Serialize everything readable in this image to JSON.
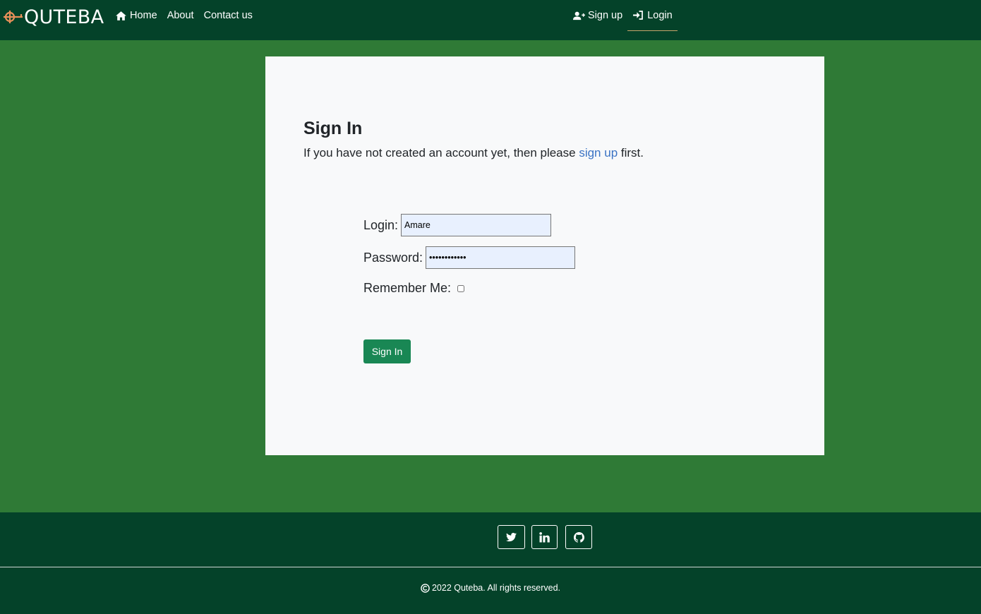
{
  "brand": {
    "name": "QUTEBA",
    "logo_color": "#e8905a"
  },
  "nav": {
    "home": "Home",
    "about": "About",
    "contact": "Contact us",
    "signup": "Sign up",
    "login": "Login"
  },
  "card": {
    "title": "Sign In",
    "sub_before": "If you have not created an account yet, then please ",
    "sub_link": "sign up",
    "sub_after": " first."
  },
  "form": {
    "login_label": "Login:",
    "login_value": "Amare",
    "password_label": "Password:",
    "password_value": "Amare1234567",
    "remember_label": "Remember Me:",
    "submit_label": "Sign In"
  },
  "footer": {
    "copyright": "2022 Quteba. All rights reserved.",
    "socials": [
      "twitter-icon",
      "linkedin-icon",
      "github-icon"
    ]
  },
  "colors": {
    "nav_bg": "#044229",
    "pattern_bg": "#8fbf8c",
    "button": "#198754",
    "link": "#3b73c4"
  }
}
